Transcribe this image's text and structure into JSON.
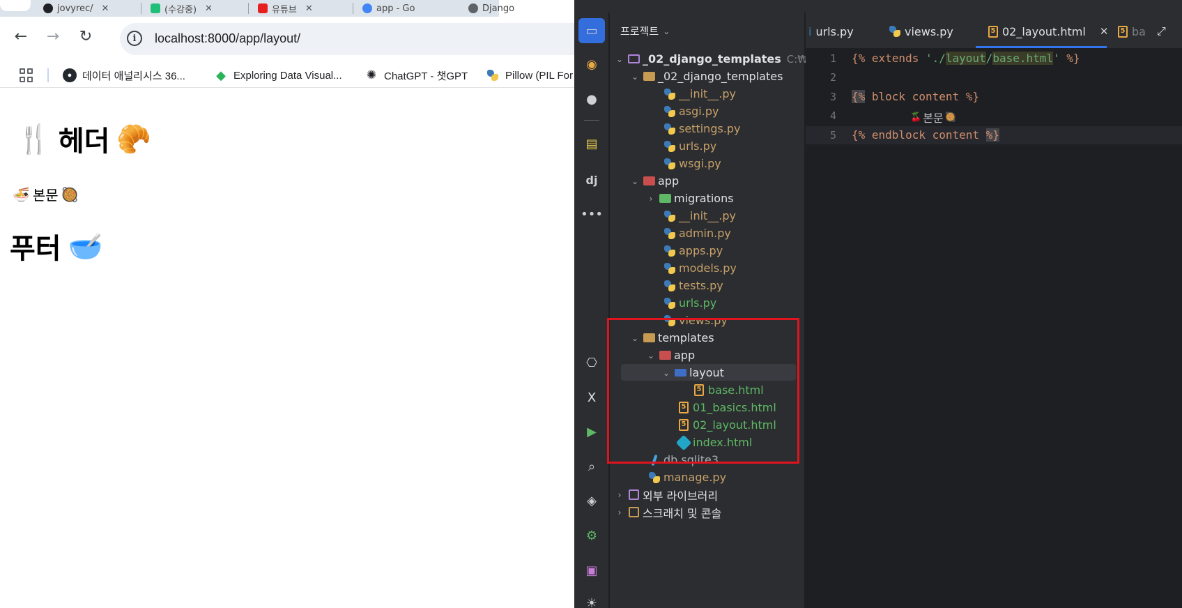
{
  "browser": {
    "tabs": [
      {
        "label": "jovyrec/",
        "color": "#202124"
      },
      {
        "label": "(수강중)",
        "color": "#1fbf7a"
      },
      {
        "label": "유튜브",
        "color": "#e81f1f"
      },
      {
        "label": "app - Go",
        "color": "#4285f4"
      },
      {
        "label": "Django",
        "color": "#5f6368"
      }
    ],
    "address": "localhost:8000/app/layout/",
    "bookmarks": [
      {
        "label": "데이터 애널리시스 36...",
        "icon": "github-icon"
      },
      {
        "label": "Exploring Data Visual...",
        "icon": "exploring-icon"
      },
      {
        "label": "ChatGPT - 챗GPT",
        "icon": "openai-icon"
      },
      {
        "label": "Pillow (PIL For",
        "icon": "python-icon"
      }
    ],
    "page": {
      "header_text": "헤더",
      "header_emoji_left": "🍴",
      "header_emoji_right": "🥐",
      "body_text": "본문",
      "body_emoji_left": "🍜",
      "body_emoji_right": "🥘",
      "footer_text": "푸터",
      "footer_emoji_right": "🥣"
    }
  },
  "ide": {
    "panel_title": "프로젝트",
    "tree": {
      "root": "_02_django_templates",
      "root_hint": "C:₩Wo",
      "pkg": "_02_django_templates",
      "pkg_files": [
        "__init__.py",
        "asgi.py",
        "settings.py",
        "urls.py",
        "wsgi.py"
      ],
      "app": "app",
      "migrations": "migrations",
      "app_files": [
        "__init__.py",
        "admin.py",
        "apps.py",
        "models.py",
        "tests.py",
        "urls.py",
        "views.py"
      ],
      "templates": "templates",
      "tmpl_app": "app",
      "layout": "layout",
      "base": "base.html",
      "basics": "01_basics.html",
      "layout_file": "02_layout.html",
      "index": "index.html",
      "db": "db.sqlite3",
      "manage": "manage.py",
      "external_libs": "외부 라이브러리",
      "scratches": "스크래치 및 콘솔"
    },
    "editor_tabs": [
      {
        "label": "urls.py"
      },
      {
        "label": "views.py"
      },
      {
        "label": "02_layout.html"
      },
      {
        "label": "ba"
      }
    ],
    "code": {
      "line_numbers": [
        "1",
        "2",
        "3",
        "4",
        "5"
      ],
      "l1_open": "{%",
      "l1_kw": " extends ",
      "l1_str_a": "'./",
      "l1_str_b": "layout",
      "l1_str_c": "/",
      "l1_str_d": "base.html",
      "l1_str_e": "'",
      "l1_close": " %}",
      "l3_open": "{%",
      "l3_rest": " block content %}",
      "l4_emoji_left": "🍒",
      "l4_text": "본문",
      "l4_emoji_right": "🥘",
      "l5_open": "{%",
      "l5_rest": " endblock content ",
      "l5_close": "%}"
    }
  }
}
